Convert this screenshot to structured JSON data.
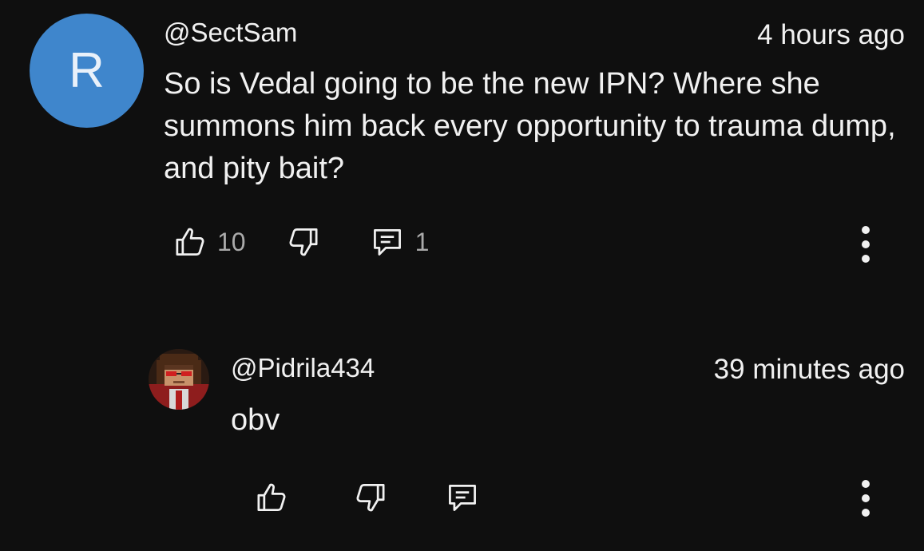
{
  "comment": {
    "avatar_letter": "R",
    "author": "@SectSam",
    "timestamp": "4 hours ago",
    "text": "So is Vedal going to be the new IPN? Where she summons him back every opportunity to trauma dump, and pity bait?",
    "likes": "10",
    "replies_count": "1",
    "icons": [
      "thumbs-up-icon",
      "thumbs-down-icon",
      "reply-comment-icon",
      "more-options-icon"
    ]
  },
  "reply": {
    "author": "@Pidrila434",
    "timestamp": "39 minutes ago",
    "text": "obv",
    "icons": [
      "thumbs-up-icon",
      "thumbs-down-icon",
      "reply-comment-icon",
      "more-options-icon"
    ]
  },
  "colors": {
    "background": "#0f0f0f",
    "avatar_blue": "#3f86cc",
    "text": "#f1f1f1",
    "secondary_text": "#aaaaaa"
  }
}
